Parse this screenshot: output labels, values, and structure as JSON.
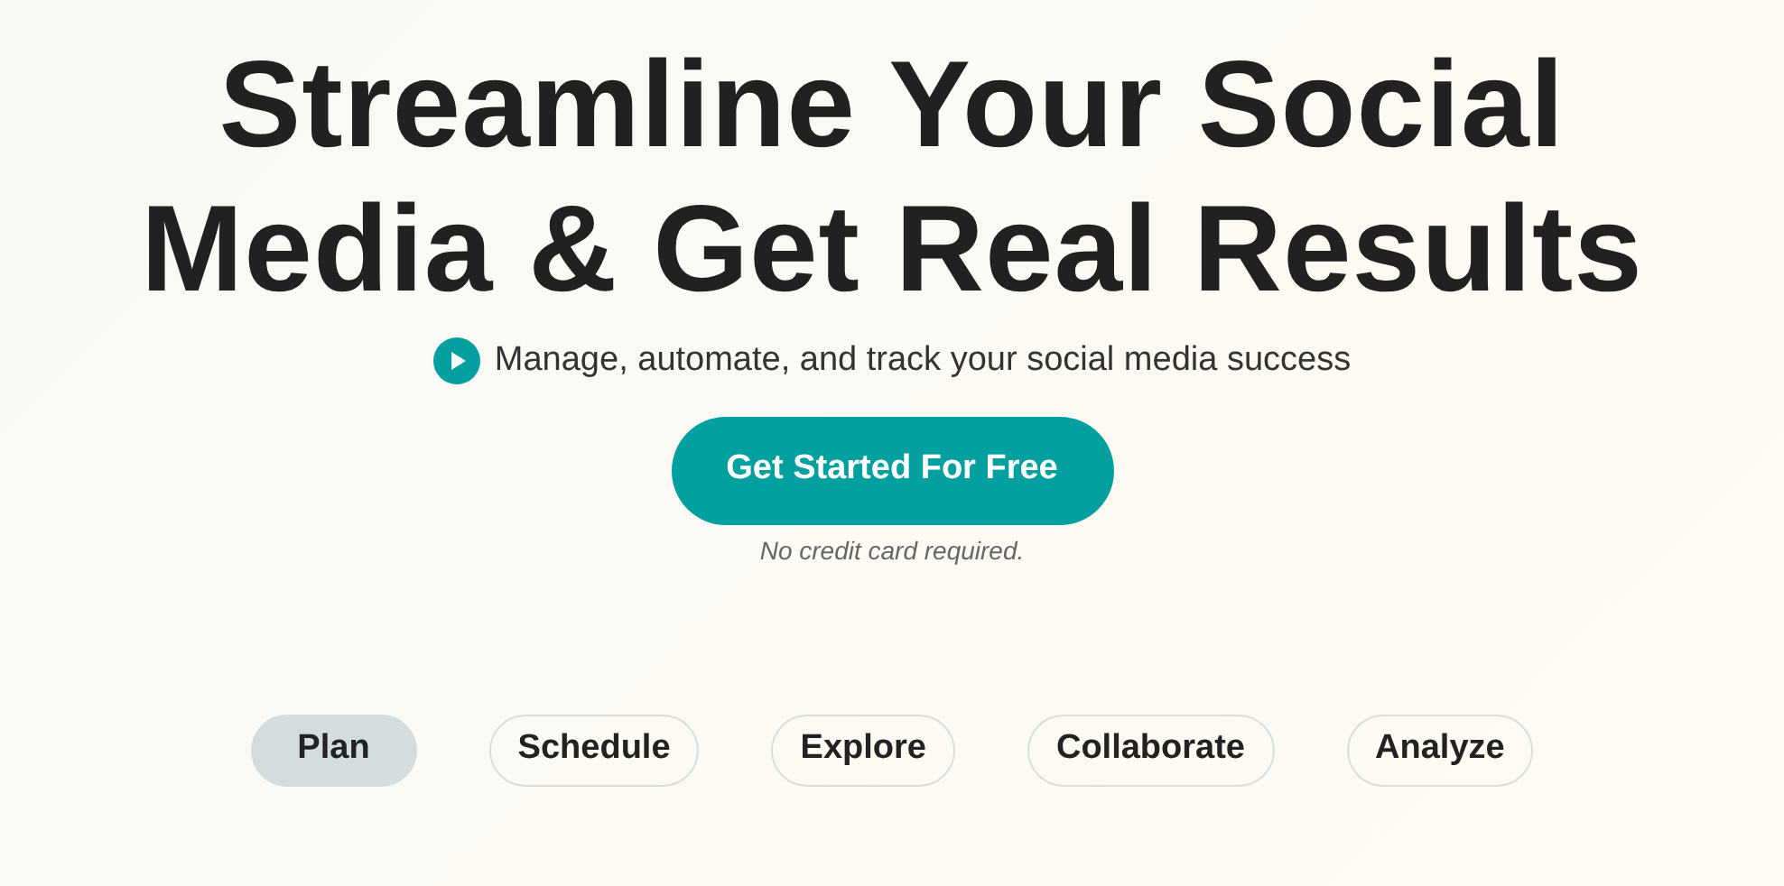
{
  "hero": {
    "title_lines": [
      "Streamline Your Social",
      "Media & Get Real Results"
    ],
    "subtitle": "Manage, automate, and track your social media success",
    "cta": "Get Started For Free",
    "note": "No credit card required."
  },
  "tabs": [
    {
      "label": "Plan",
      "selected": true
    },
    {
      "label": "Schedule",
      "selected": false
    },
    {
      "label": "Explore",
      "selected": false
    },
    {
      "label": "Collaborate",
      "selected": false
    },
    {
      "label": "Analyze",
      "selected": false
    }
  ]
}
